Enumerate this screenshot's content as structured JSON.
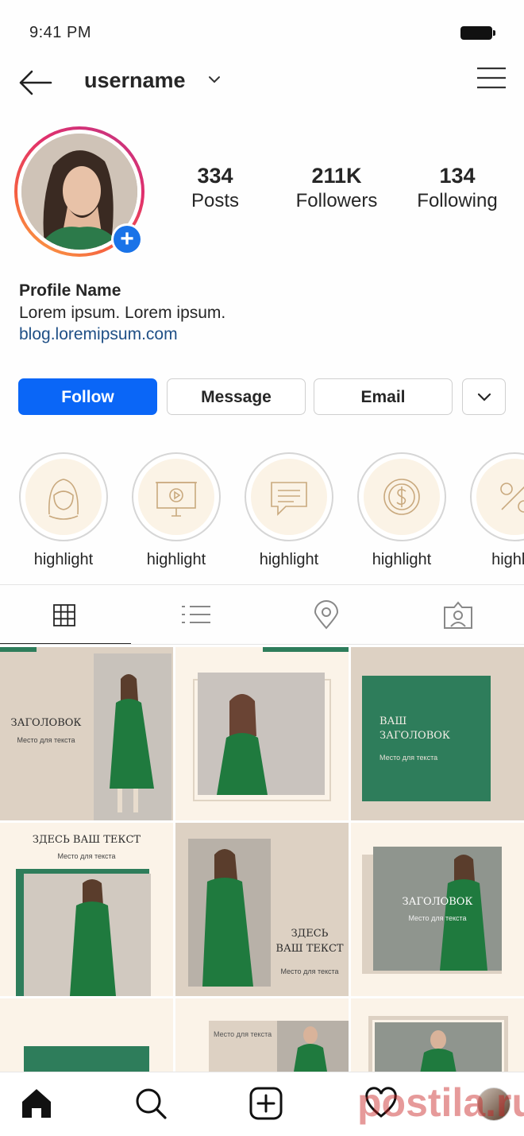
{
  "status": {
    "time": "9:41 PM"
  },
  "header": {
    "username": "username"
  },
  "stats": [
    {
      "value": "334",
      "label": "Posts"
    },
    {
      "value": "211K",
      "label": "Followers"
    },
    {
      "value": "134",
      "label": "Following"
    }
  ],
  "bio": {
    "name": "Profile Name",
    "text": "Lorem ipsum. Lorem ipsum.",
    "link": "blog.loremipsum.com"
  },
  "buttons": {
    "follow": "Follow",
    "message": "Message",
    "email": "Email"
  },
  "highlights": [
    {
      "label": "highlight",
      "icon": "woman-face-icon"
    },
    {
      "label": "highlight",
      "icon": "presentation-icon"
    },
    {
      "label": "highlight",
      "icon": "chat-bubble-icon"
    },
    {
      "label": "highlight",
      "icon": "dollar-coin-icon"
    },
    {
      "label": "highlig",
      "icon": "percent-icon"
    }
  ],
  "tabs": [
    "grid-icon",
    "list-icon",
    "location-pin-icon",
    "tagged-user-icon"
  ],
  "posts": {
    "p1": {
      "title": "ЗАГОЛОВОК",
      "sub": "Место для текста"
    },
    "p3": {
      "title1": "ВАШ",
      "title2": "ЗАГОЛОВОК",
      "sub": "Место для текста"
    },
    "p4": {
      "title": "ЗДЕСЬ ВАШ ТЕКСТ",
      "sub": "Место для текста"
    },
    "p5": {
      "title1": "ЗДЕСЬ",
      "title2": "ВАШ ТЕКСТ",
      "sub": "Место для текста"
    },
    "p6": {
      "title": "ЗАГОЛОВОК",
      "sub": "Место для текста"
    },
    "p8": {
      "sub": "Место для текста"
    }
  },
  "watermark": "postila.ru",
  "colors": {
    "accent": "#0a66f7",
    "brand_green": "#2e7d5b",
    "beige": "#ddd1c3"
  }
}
